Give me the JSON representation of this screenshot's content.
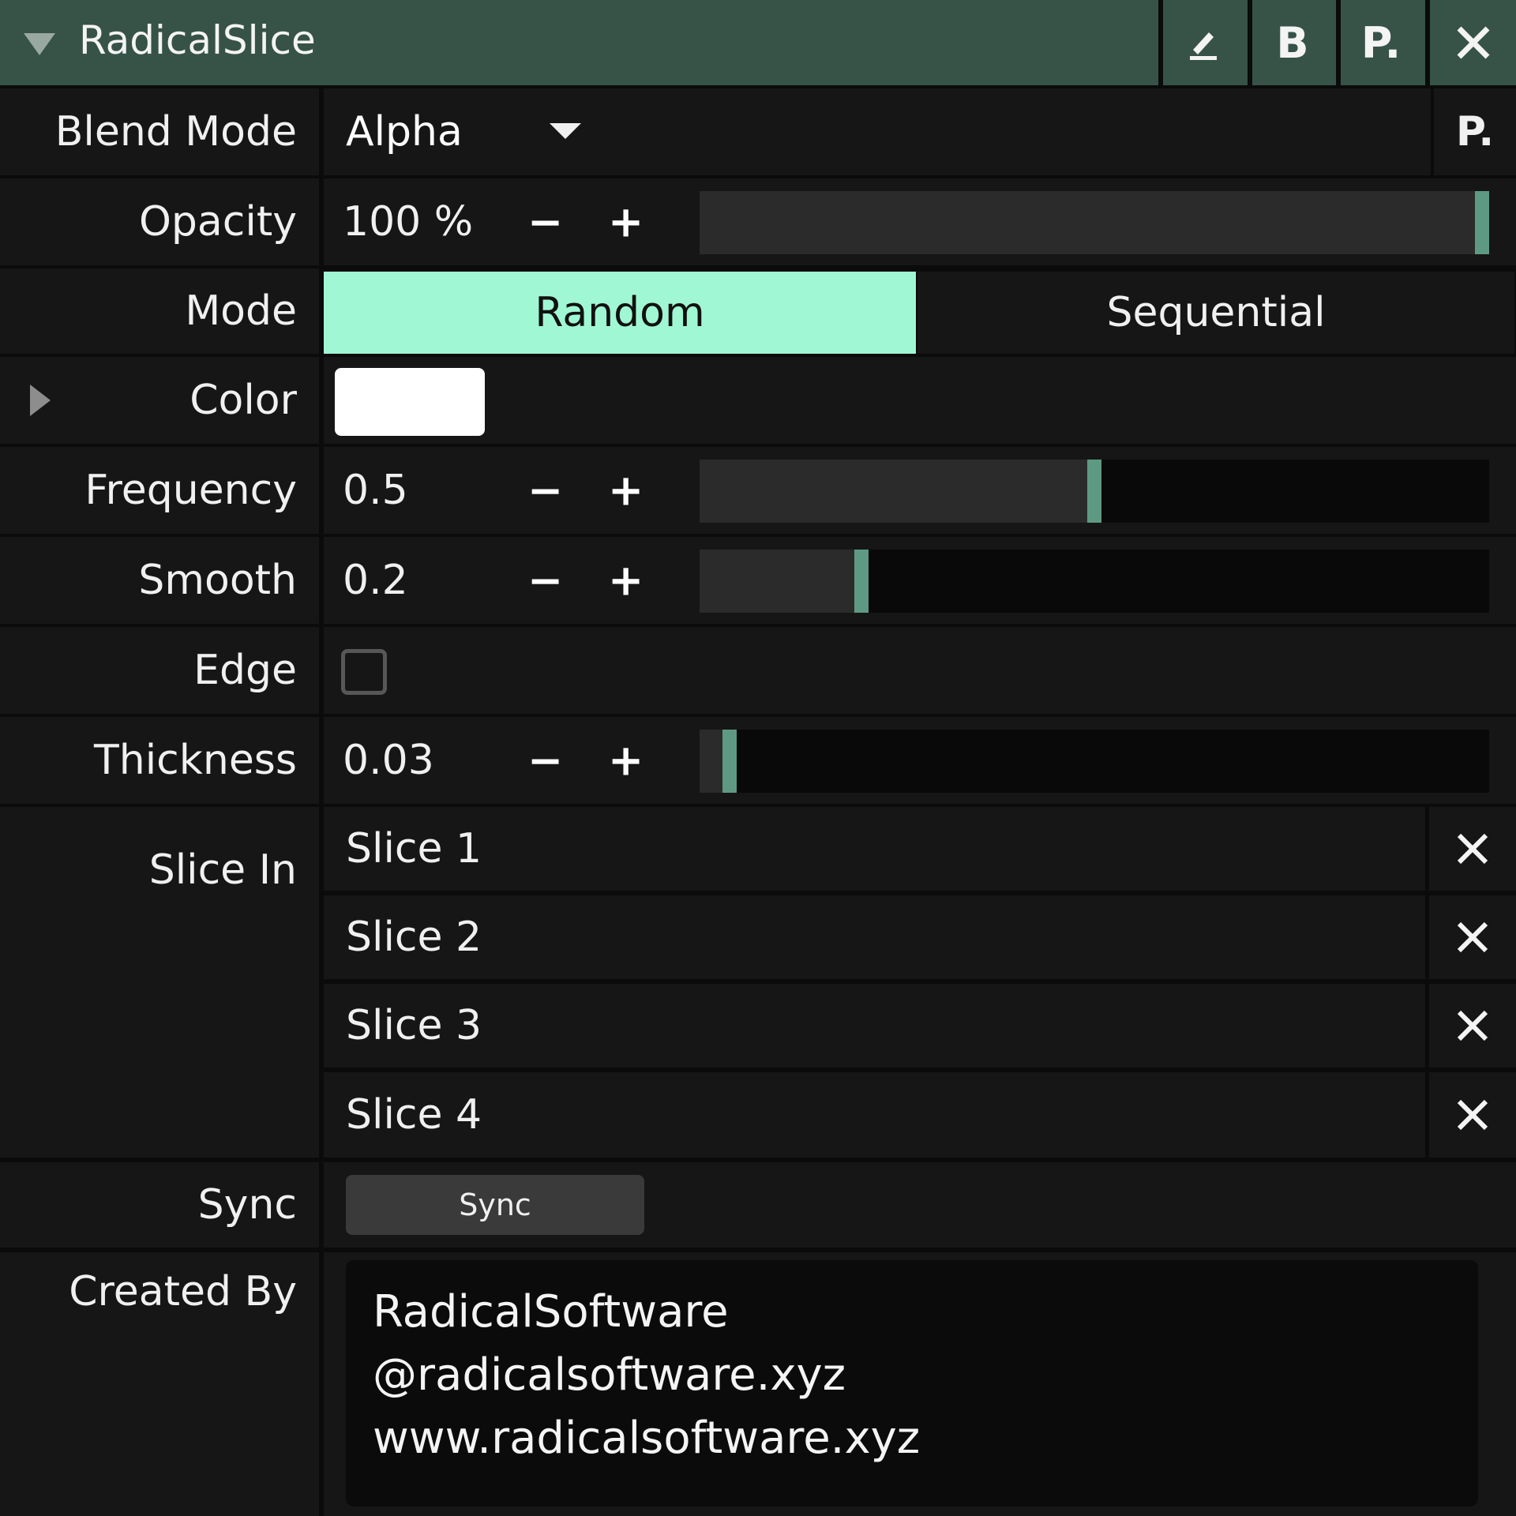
{
  "panel": {
    "title": "RadicalSlice",
    "header_buttons": [
      {
        "icon": "pencil-icon"
      },
      {
        "label": "B"
      },
      {
        "label": "P."
      },
      {
        "icon": "close-icon"
      }
    ]
  },
  "rows": {
    "blend_mode": {
      "label": "Blend Mode",
      "value": "Alpha",
      "preset_label": "P."
    },
    "opacity": {
      "label": "Opacity",
      "value": "100 %",
      "level": 1.0
    },
    "mode": {
      "label": "Mode",
      "options": [
        "Random",
        "Sequential"
      ],
      "selected": "Random"
    },
    "color": {
      "label": "Color",
      "swatch": "#ffffff"
    },
    "frequency": {
      "label": "Frequency",
      "value": "0.5",
      "level": 0.5
    },
    "smooth": {
      "label": "Smooth",
      "value": "0.2",
      "level": 0.2
    },
    "edge": {
      "label": "Edge",
      "checked": false
    },
    "thickness": {
      "label": "Thickness",
      "value": "0.03",
      "level": 0.03
    },
    "slice_in": {
      "label": "Slice In",
      "items": [
        "Slice 1",
        "Slice 2",
        "Slice 3",
        "Slice 4"
      ]
    },
    "sync": {
      "label": "Sync",
      "button_label": "Sync"
    },
    "created_by": {
      "label": "Created By",
      "lines": [
        "RadicalSoftware",
        "@radicalsoftware.xyz",
        "www.radicalsoftware.xyz"
      ]
    }
  },
  "controls": {
    "minus": "−",
    "plus": "+"
  },
  "colors": {
    "header": "#375348",
    "accent": "#a0f7d4",
    "slider_handle": "#5e9a83",
    "row_bg": "#161616"
  }
}
